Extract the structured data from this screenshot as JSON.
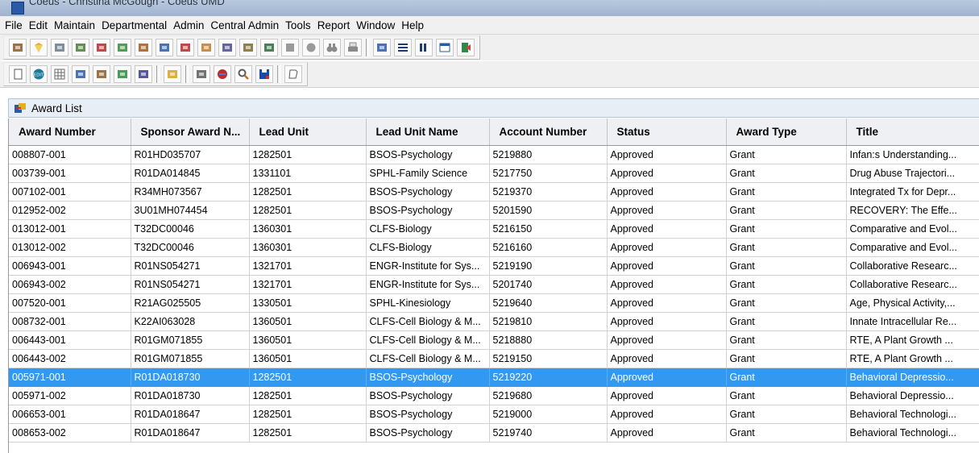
{
  "window": {
    "title": "Coeus - Christina McGough - Coeus UMD"
  },
  "menu": [
    "File",
    "Edit",
    "Maintain",
    "Departmental",
    "Admin",
    "Central Admin",
    "Tools",
    "Report",
    "Window",
    "Help"
  ],
  "toolbar1": [
    {
      "icon": "award-icon",
      "color": "#8a5a2b"
    },
    {
      "icon": "gem-icon",
      "color": "#e8b21b"
    },
    {
      "icon": "copy-icon",
      "color": "#6a7a8a"
    },
    {
      "icon": "sort-icon",
      "color": "#4a7a3a"
    },
    {
      "icon": "stack-icon",
      "color": "#b02a2a"
    },
    {
      "icon": "person-money-icon",
      "color": "#3a8a3a"
    },
    {
      "icon": "team-icon",
      "color": "#a05a20"
    },
    {
      "icon": "org-chart-icon",
      "color": "#2a5aa6"
    },
    {
      "icon": "edit-formula-icon",
      "color": "#b02a2a"
    },
    {
      "icon": "tree-icon",
      "color": "#c07a2a"
    },
    {
      "icon": "users-icon",
      "color": "#4a4a8a"
    },
    {
      "icon": "group-icon",
      "color": "#7a6a2a"
    },
    {
      "icon": "hierarchy-icon",
      "color": "#2a6a3a"
    },
    {
      "icon": "disabled-square-icon",
      "color": "#9a9a9a"
    },
    {
      "icon": "disabled-circle-icon",
      "color": "#9a9a9a"
    },
    {
      "icon": "binoculars-icon",
      "color": "#8a8a8a"
    },
    {
      "icon": "printer-icon",
      "color": "#8a8a8a"
    },
    {
      "icon": "sep"
    },
    {
      "icon": "network-icon",
      "color": "#2a5aa6"
    },
    {
      "icon": "list-icon",
      "color": "#1a3a7a"
    },
    {
      "icon": "columns-icon",
      "color": "#1a3a7a"
    },
    {
      "icon": "window-icon",
      "color": "#2a5aa6"
    },
    {
      "icon": "exit-icon",
      "color": "#2a8a4a"
    }
  ],
  "toolbar2": [
    {
      "icon": "new-doc-icon",
      "color": "#5a5a5a"
    },
    {
      "icon": "edit-icon",
      "color": "#1a7a9a"
    },
    {
      "icon": "grid-icon",
      "color": "#6a6a6a"
    },
    {
      "icon": "transfer-icon",
      "color": "#2a5aa6"
    },
    {
      "icon": "hierarchy2-icon",
      "color": "#8a5a2a"
    },
    {
      "icon": "notepad-icon",
      "color": "#2a8a3a"
    },
    {
      "icon": "report-icon",
      "color": "#3a3a8a"
    },
    {
      "icon": "sep"
    },
    {
      "icon": "puzzle-icon",
      "color": "#d8a020"
    },
    {
      "icon": "sep"
    },
    {
      "icon": "clip-icon",
      "color": "#5a5a5a"
    },
    {
      "icon": "delete-icon",
      "color": "#c02a2a"
    },
    {
      "icon": "search-icon",
      "color": "#5a5a5a"
    },
    {
      "icon": "save-icon",
      "color": "#1a4aa6"
    },
    {
      "icon": "sep"
    },
    {
      "icon": "close-doc-icon",
      "color": "#5a5a5a"
    }
  ],
  "panel": {
    "title": "Award List"
  },
  "table": {
    "headers": [
      "Award Number",
      "Sponsor Award N...",
      "Lead Unit",
      "Lead Unit Name",
      "Account Number",
      "Status",
      "Award Type",
      "Title"
    ],
    "rows": [
      [
        "008807-001",
        "R01HD035707",
        "1282501",
        "BSOS-Psychology",
        "5219880",
        "Approved",
        "Grant",
        "Infan:s Understanding..."
      ],
      [
        "003739-001",
        "R01DA014845",
        "1331101",
        "SPHL-Family Science",
        "5217750",
        "Approved",
        "Grant",
        "Drug Abuse Trajectori..."
      ],
      [
        "007102-001",
        "R34MH073567",
        "1282501",
        "BSOS-Psychology",
        "5219370",
        "Approved",
        "Grant",
        "Integrated Tx for Depr..."
      ],
      [
        "012952-002",
        "3U01MH074454",
        "1282501",
        "BSOS-Psychology",
        "5201590",
        "Approved",
        "Grant",
        "RECOVERY: The Effe..."
      ],
      [
        "013012-001",
        "T32DC00046",
        "1360301",
        "CLFS-Biology",
        "5216150",
        "Approved",
        "Grant",
        "Comparative and Evol..."
      ],
      [
        "013012-002",
        "T32DC00046",
        "1360301",
        "CLFS-Biology",
        "5216160",
        "Approved",
        "Grant",
        "Comparative and Evol..."
      ],
      [
        "006943-001",
        "R01NS054271",
        "1321701",
        "ENGR-Institute for Sys...",
        "5219190",
        "Approved",
        "Grant",
        "Collaborative Researc..."
      ],
      [
        "006943-002",
        "R01NS054271",
        "1321701",
        "ENGR-Institute for Sys...",
        "5201740",
        "Approved",
        "Grant",
        "Collaborative Researc..."
      ],
      [
        "007520-001",
        "R21AG025505",
        "1330501",
        "SPHL-Kinesiology",
        "5219640",
        "Approved",
        "Grant",
        "Age, Physical Activity,..."
      ],
      [
        "008732-001",
        "K22AI063028",
        "1360501",
        "CLFS-Cell Biology & M...",
        "5219810",
        "Approved",
        "Grant",
        "Innate Intracellular Re..."
      ],
      [
        "006443-001",
        "R01GM071855",
        "1360501",
        "CLFS-Cell Biology & M...",
        "5218880",
        "Approved",
        "Grant",
        "RTE, A Plant Growth ..."
      ],
      [
        "006443-002",
        "R01GM071855",
        "1360501",
        "CLFS-Cell Biology & M...",
        "5219150",
        "Approved",
        "Grant",
        "RTE, A Plant Growth ..."
      ],
      [
        "005971-001",
        "R01DA018730",
        "1282501",
        "BSOS-Psychology",
        "5219220",
        "Approved",
        "Grant",
        "Behavioral Depressio..."
      ],
      [
        "005971-002",
        "R01DA018730",
        "1282501",
        "BSOS-Psychology",
        "5219680",
        "Approved",
        "Grant",
        "Behavioral Depressio..."
      ],
      [
        "006653-001",
        "R01DA018647",
        "1282501",
        "BSOS-Psychology",
        "5219000",
        "Approved",
        "Grant",
        "Behavioral Technologi..."
      ],
      [
        "008653-002",
        "R01DA018647",
        "1282501",
        "BSOS-Psychology",
        "5219740",
        "Approved",
        "Grant",
        "Behavioral Technologi..."
      ]
    ],
    "selected_row_index": 12,
    "selection_color": "#3398f0"
  }
}
